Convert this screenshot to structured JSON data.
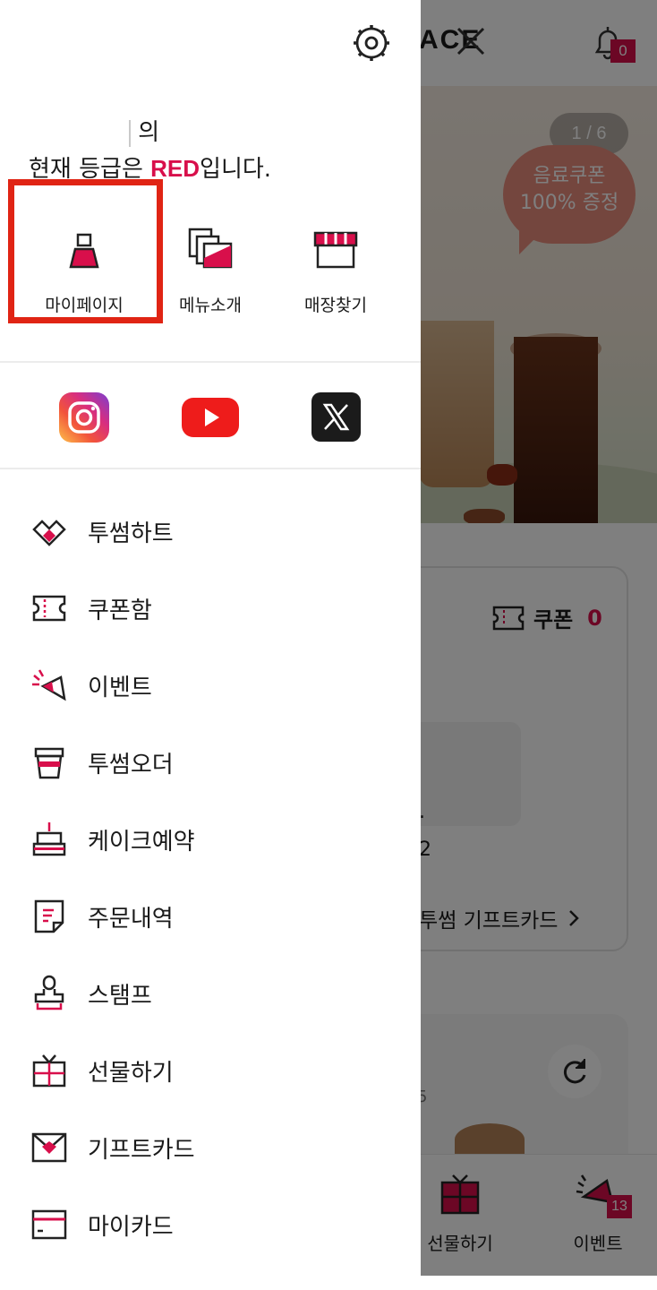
{
  "background": {
    "brand_fragment": "ACE",
    "notification_count": "0",
    "banner": {
      "pager": "1 / 6",
      "bubble_line1": "음료쿠폰",
      "bubble_line2": "100% 증정"
    },
    "coupon": {
      "label": "쿠폰",
      "count": "0"
    },
    "partial_number": "2",
    "partial_dot": ".",
    "giftcard_link": "투썸 기프트카드",
    "partial_five": "5",
    "bottom_nav": [
      {
        "label": "선물하기"
      },
      {
        "label": "이벤트",
        "badge": "13"
      }
    ]
  },
  "drawer": {
    "greeting_suffix": "의",
    "grade_prefix": "현재 등급은 ",
    "grade_value": "RED",
    "grade_suffix": "입니다.",
    "quick_links": [
      {
        "label": "마이페이지",
        "icon": "mypage-icon"
      },
      {
        "label": "메뉴소개",
        "icon": "menu-intro-icon"
      },
      {
        "label": "매장찾기",
        "icon": "store-icon"
      }
    ],
    "social": [
      "instagram-icon",
      "youtube-icon",
      "x-icon"
    ],
    "menu": [
      {
        "label": "투썸하트",
        "icon": "heart-icon"
      },
      {
        "label": "쿠폰함",
        "icon": "coupon-icon"
      },
      {
        "label": "이벤트",
        "icon": "megaphone-icon"
      },
      {
        "label": "투썸오더",
        "icon": "cup-icon"
      },
      {
        "label": "케이크예약",
        "icon": "cake-icon"
      },
      {
        "label": "주문내역",
        "icon": "receipt-icon"
      },
      {
        "label": "스탬프",
        "icon": "stamp-icon"
      },
      {
        "label": "선물하기",
        "icon": "gift-icon"
      },
      {
        "label": "기프트카드",
        "icon": "giftcard-icon"
      },
      {
        "label": "마이카드",
        "icon": "card-icon"
      }
    ]
  },
  "colors": {
    "accent": "#d80f4b",
    "highlight": "#e02414"
  }
}
